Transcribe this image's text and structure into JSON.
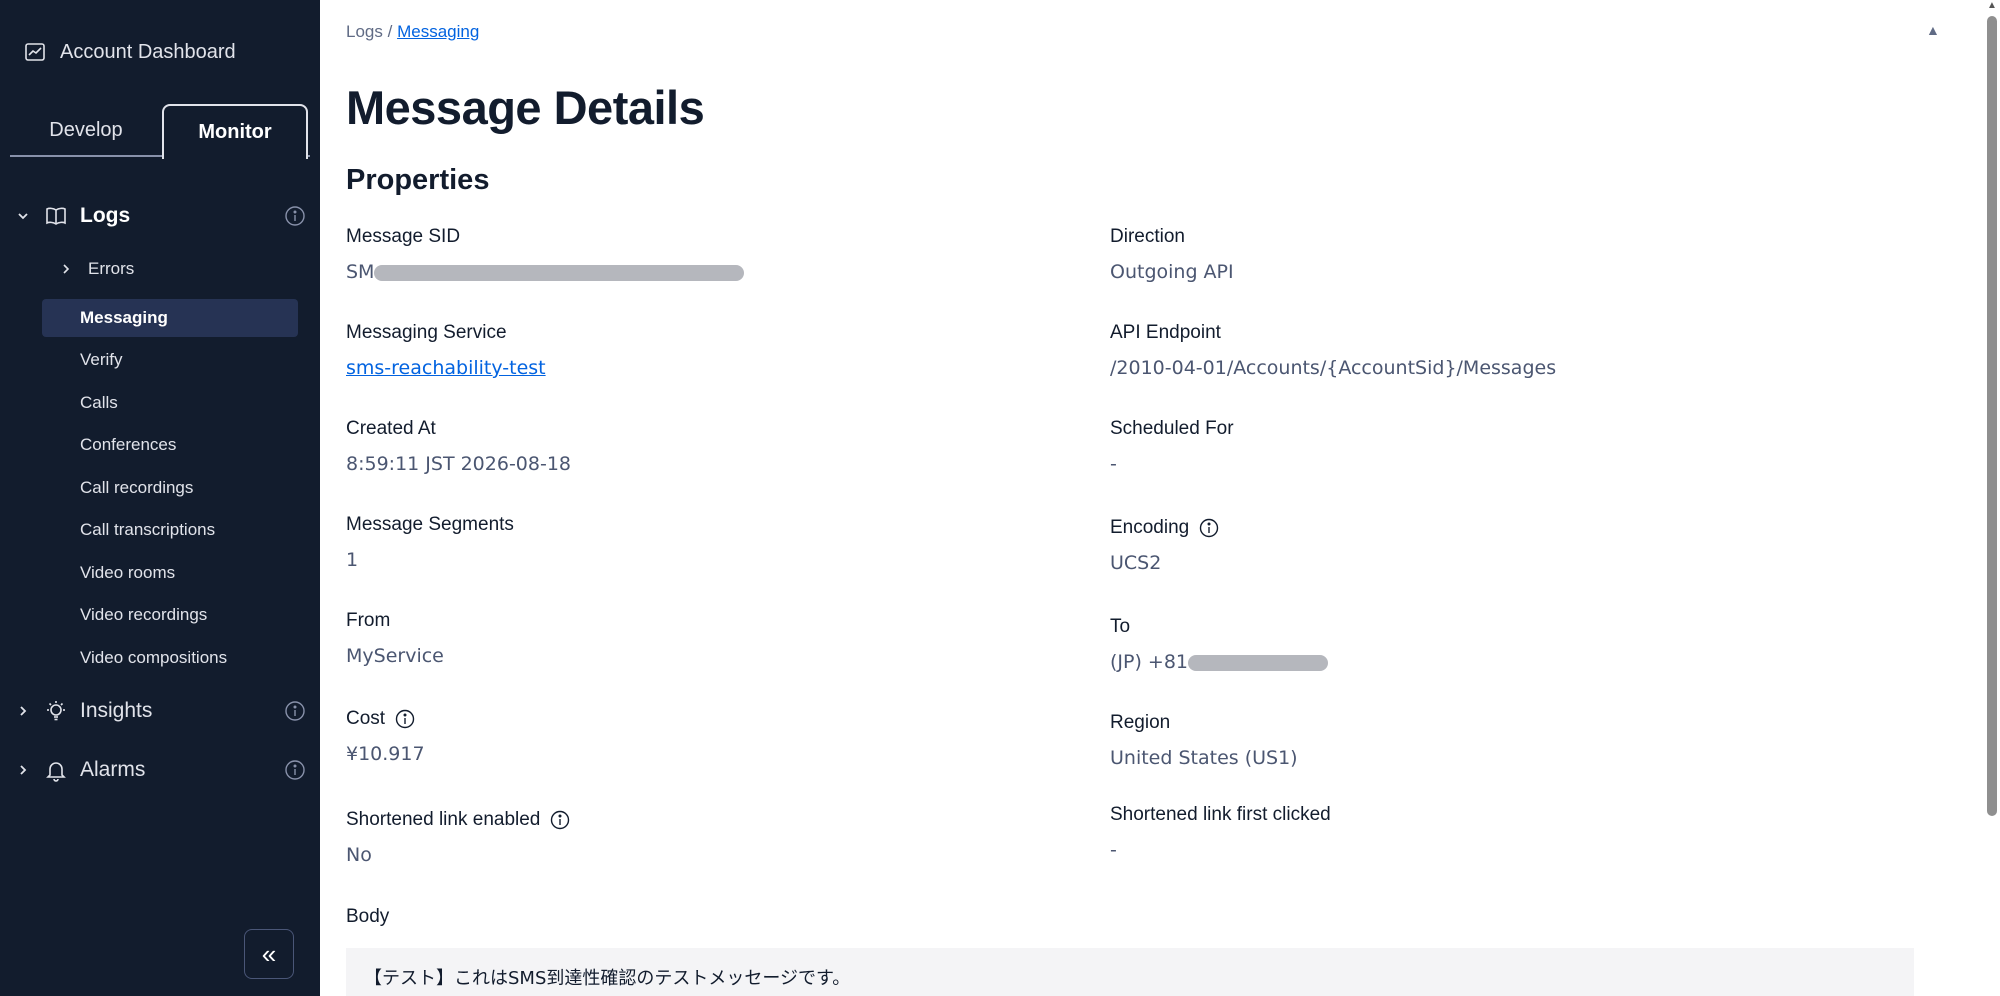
{
  "sidebar": {
    "header": "Account Dashboard",
    "tabs": {
      "develop": "Develop",
      "monitor": "Monitor"
    },
    "logs": {
      "label": "Logs",
      "errors": "Errors",
      "items": [
        "Messaging",
        "Verify",
        "Calls",
        "Conferences",
        "Call recordings",
        "Call transcriptions",
        "Video rooms",
        "Video recordings",
        "Video compositions"
      ]
    },
    "insights": "Insights",
    "alarms": "Alarms",
    "collapse": "«"
  },
  "breadcrumb": {
    "root": "Logs",
    "sep": "/",
    "current": "Messaging"
  },
  "page_title": "Message Details",
  "section_title": "Properties",
  "props": {
    "message_sid": {
      "label": "Message SID",
      "value_prefix": "SM"
    },
    "direction": {
      "label": "Direction",
      "value": "Outgoing API"
    },
    "messaging_service": {
      "label": "Messaging Service",
      "value": "sms-reachability-test"
    },
    "api_endpoint": {
      "label": "API Endpoint",
      "value": "/2010-04-01/Accounts/{AccountSid}/Messages"
    },
    "created_at": {
      "label": "Created At",
      "value": "8:59:11 JST 2026-08-18"
    },
    "scheduled_for": {
      "label": "Scheduled For",
      "value": "-"
    },
    "message_segments": {
      "label": "Message Segments",
      "value": "1"
    },
    "encoding": {
      "label": "Encoding",
      "value": "UCS2"
    },
    "from": {
      "label": "From",
      "value": "MyService"
    },
    "to": {
      "label": "To",
      "value_prefix": "(JP) +81"
    },
    "cost": {
      "label": "Cost",
      "value": "¥10.917"
    },
    "region": {
      "label": "Region",
      "value": "United States (US1)"
    },
    "shortened_link_enabled": {
      "label": "Shortened link enabled",
      "value": "No"
    },
    "shortened_link_first_clicked": {
      "label": "Shortened link first clicked",
      "value": "-"
    }
  },
  "body": {
    "label": "Body",
    "text": "【テスト】これはSMS到達性確認のテストメッセージです。"
  }
}
